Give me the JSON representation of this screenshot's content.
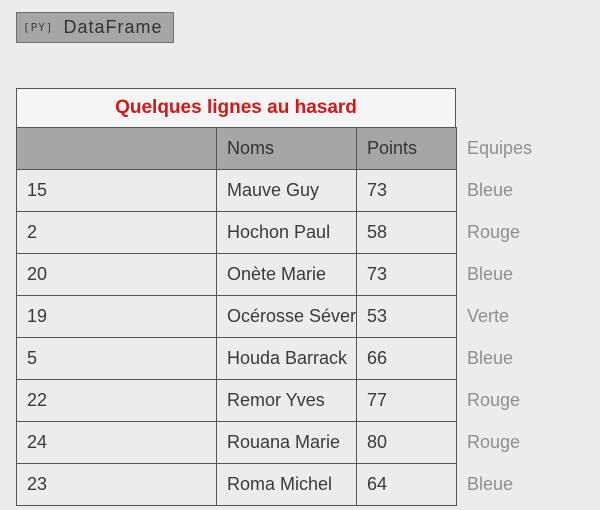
{
  "badge": {
    "icon": "[PY]",
    "label": "DataFrame"
  },
  "table": {
    "caption": "Quelques lignes au hasard",
    "headers": {
      "index": "",
      "noms": "Noms",
      "points": "Points",
      "equipes": "Equipes"
    },
    "rows": [
      {
        "index": "15",
        "noms": "Mauve Guy",
        "points": "73",
        "equipes": "Bleue"
      },
      {
        "index": "2",
        "noms": "Hochon Paul",
        "points": "58",
        "equipes": "Rouge"
      },
      {
        "index": "20",
        "noms": "Onète Marie",
        "points": "73",
        "equipes": "Bleue"
      },
      {
        "index": "19",
        "noms": "Océrosse Séverine",
        "points": "53",
        "equipes": "Verte"
      },
      {
        "index": "5",
        "noms": "Houda Barrack",
        "points": "66",
        "equipes": "Bleue"
      },
      {
        "index": "22",
        "noms": "Remor Yves",
        "points": "77",
        "equipes": "Rouge"
      },
      {
        "index": "24",
        "noms": "Rouana Marie",
        "points": "80",
        "equipes": "Rouge"
      },
      {
        "index": "23",
        "noms": "Roma Michel",
        "points": "64",
        "equipes": "Bleue"
      }
    ]
  }
}
